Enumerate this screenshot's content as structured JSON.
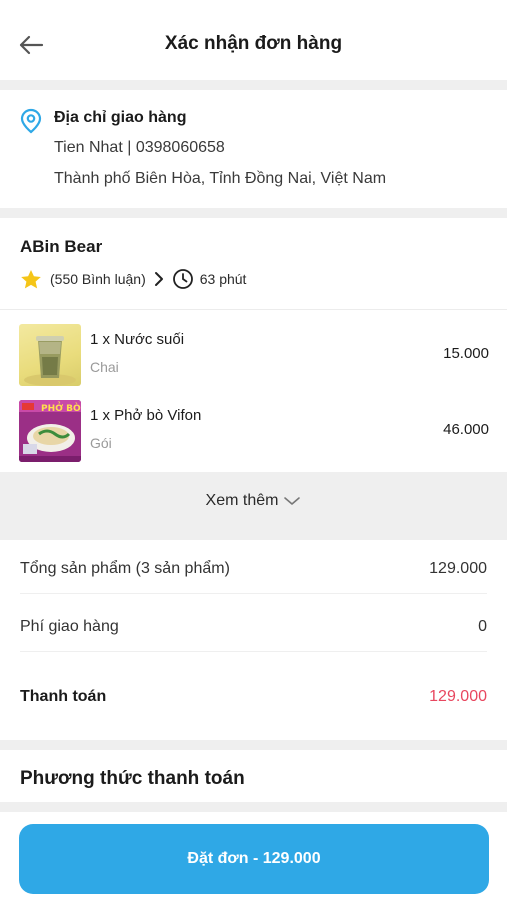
{
  "header": {
    "title": "Xác nhận đơn hàng",
    "back_icon": "arrow-left-icon"
  },
  "address": {
    "title": "Địa chỉ giao hàng",
    "contact": "Tien Nhat | 0398060658",
    "location": "Thành phố Biên Hòa, Tỉnh Đồng Nai, Việt Nam",
    "icon": "location-pin-icon",
    "icon_color": "#2fa8e6"
  },
  "store": {
    "name": "ABin Bear",
    "reviews": "(550 Bình luận)",
    "time": "63 phút",
    "star_color": "#f5c518"
  },
  "items": [
    {
      "name": "1 x Nước suối",
      "unit": "Chai",
      "price": "15.000",
      "image": "bottled-drink-image"
    },
    {
      "name": "1 x Phở bò Vifon",
      "unit": "Gói",
      "price": "46.000",
      "image": "pho-bo-package-image"
    }
  ],
  "more": {
    "label": "Xem thêm"
  },
  "summary": {
    "subtotal_label": "Tổng sản phẩm (3 sản phẩm)",
    "subtotal_value": "129.000",
    "shipping_label": "Phí giao hàng",
    "shipping_value": "0",
    "total_label": "Thanh toán",
    "total_value": "129.000",
    "total_color": "#e8475f"
  },
  "payment": {
    "title": "Phương thức thanh toán"
  },
  "cta": {
    "label": "Đặt đơn - 129.000",
    "color": "#2fa8e6"
  }
}
